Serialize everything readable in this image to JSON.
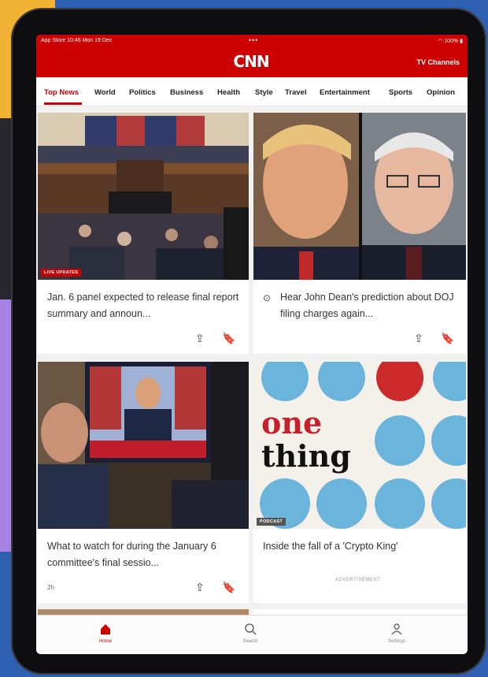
{
  "status_bar": {
    "left": "App Store 10:46 Mon 19 Dec",
    "center": "•••",
    "right": "100%"
  },
  "header": {
    "logo": "CNN",
    "tv_channels": "TV Channels"
  },
  "nav": {
    "tabs": [
      "Top News",
      "World",
      "Politics",
      "Business",
      "Health",
      "Style",
      "Travel",
      "Entertainment",
      "Sports",
      "Opinion"
    ],
    "active_index": 0
  },
  "stories": [
    {
      "title": "Jan. 6 panel expected to release final report summary and announ...",
      "badge": "LIVE UPDATES",
      "image_icon": "hearing-room-image"
    },
    {
      "title": "Hear John Dean's prediction about DOJ filing charges again...",
      "video": true,
      "image_icon": "portraits-image"
    },
    {
      "title": "What to watch for during the January 6 committee's final sessio...",
      "timestamp": "2h",
      "image_icon": "committee-screen-image"
    },
    {
      "title": "Inside the fall of a 'Crypto King'",
      "badge": "PODCAST",
      "image_icon": "one-thing-podcast-image",
      "podcast_line1": "one",
      "podcast_line2": "thing"
    }
  ],
  "advertisement": "ADVERTISEMENT",
  "bottom_tabs": [
    {
      "label": "Home",
      "icon": "home-icon",
      "active": true
    },
    {
      "label": "Search",
      "icon": "search-icon",
      "active": false
    },
    {
      "label": "Settings",
      "icon": "person-icon",
      "active": false
    }
  ],
  "colors": {
    "brand": "#cc0000",
    "feed_bg": "#f1f1f1",
    "podcast_blue": "#6bb4dc",
    "podcast_red": "#cc2a2a"
  }
}
